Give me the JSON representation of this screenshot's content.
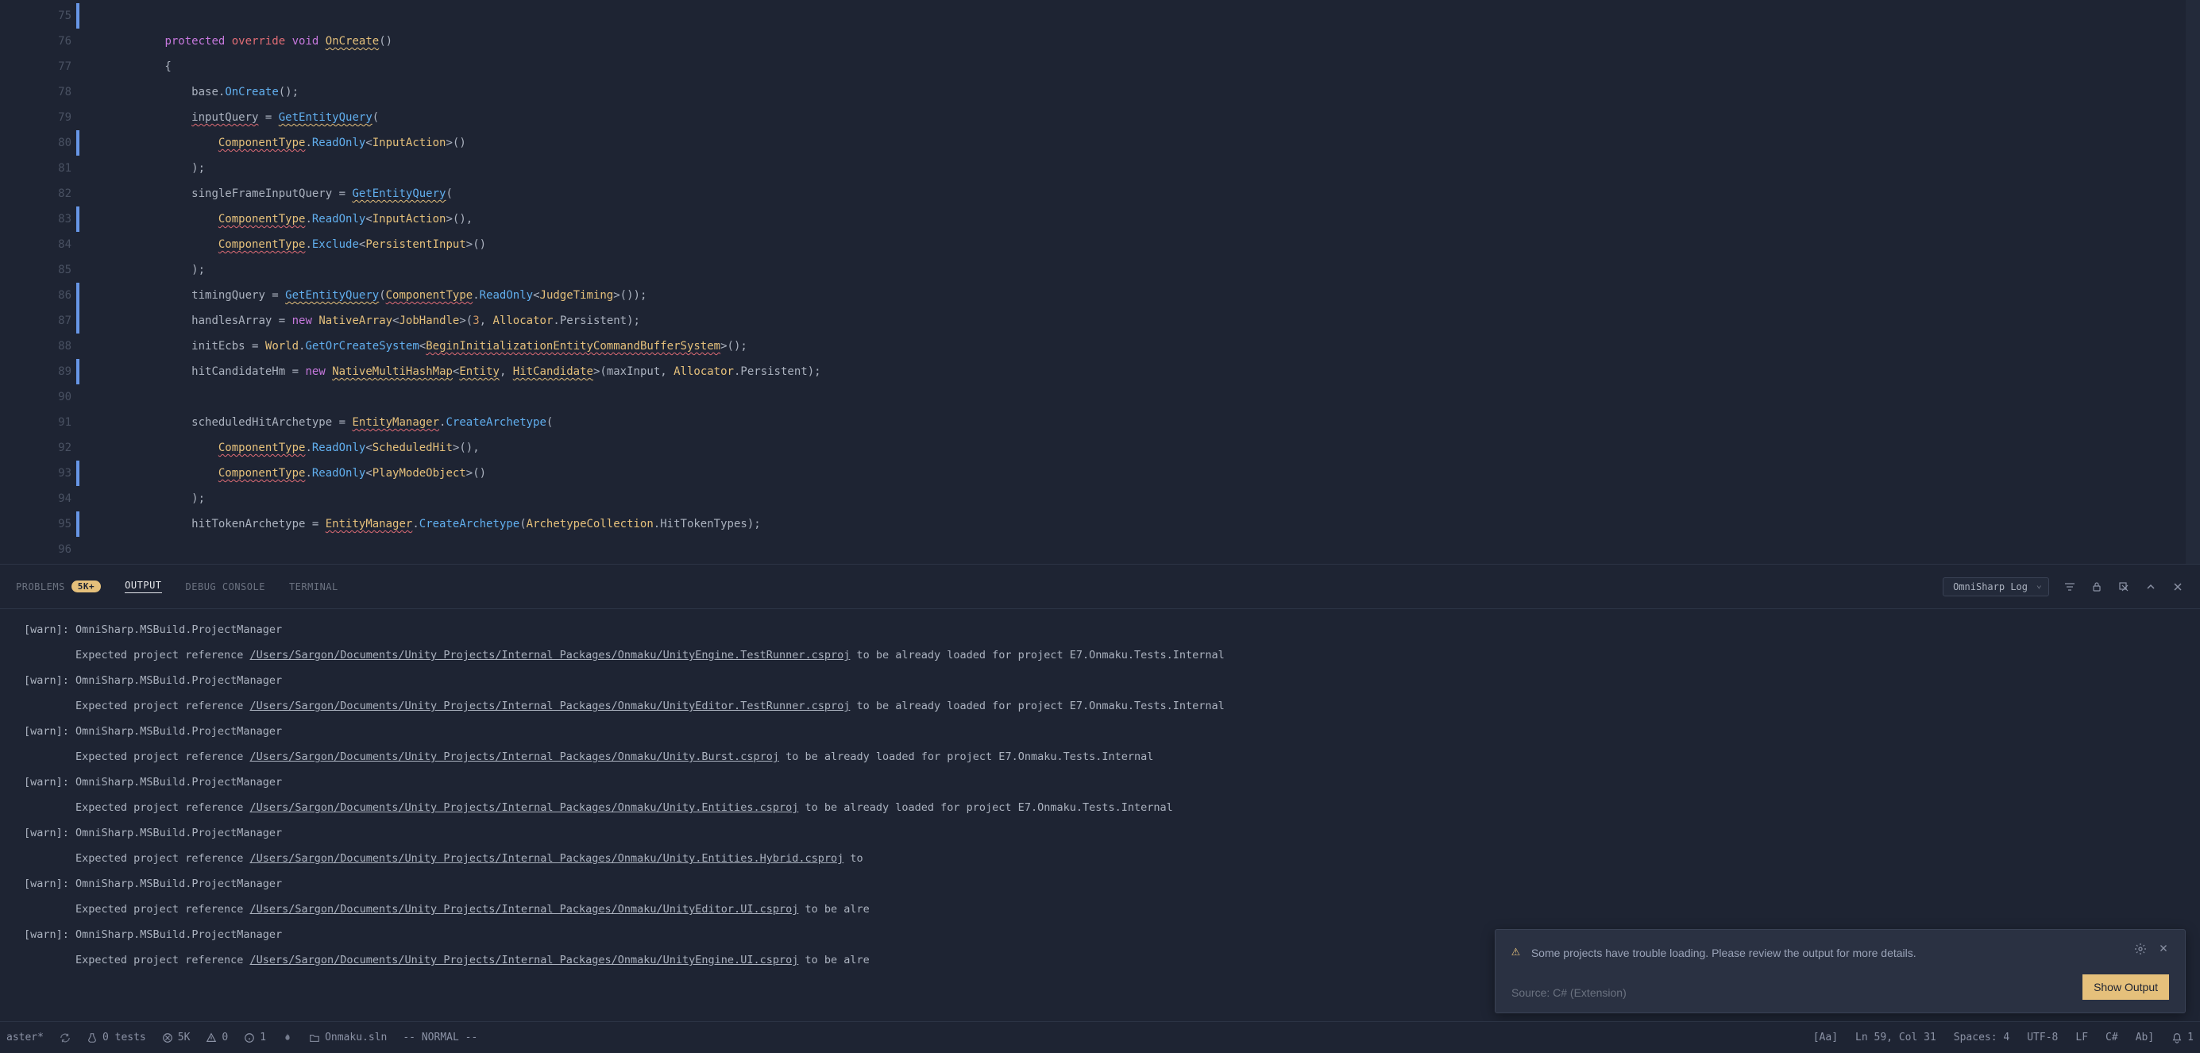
{
  "gutter": {
    "start": 75,
    "end": 96,
    "modified": [
      75,
      80,
      83,
      86,
      87,
      89,
      93,
      95
    ]
  },
  "code": [
    {
      "n": 75,
      "raw": ""
    },
    {
      "n": 76,
      "html": "        <span class='kw'>protected</span> <span class='over'>override</span> <span class='kw'>void</span> <span class='oncreate squiggle-y'>OnCreate</span>()"
    },
    {
      "n": 77,
      "html": "        {"
    },
    {
      "n": 78,
      "html": "            <span class='ident'>base</span>.<span class='method'>OnCreate</span>();"
    },
    {
      "n": 79,
      "html": "            <span class='squiggle'>inputQuery</span> = <span class='method squiggle-y'>GetEntityQuery</span>("
    },
    {
      "n": 80,
      "html": "                <span class='type squiggle'>ComponentType</span>.<span class='method'>ReadOnly</span>&lt;<span class='type'>InputAction</span>&gt;()"
    },
    {
      "n": 81,
      "html": "            );"
    },
    {
      "n": 82,
      "html": "            <span class='ident'>singleFrameInputQuery</span> = <span class='method squiggle-y'>GetEntityQuery</span>("
    },
    {
      "n": 83,
      "html": "                <span class='type squiggle'>ComponentType</span>.<span class='method'>ReadOnly</span>&lt;<span class='type'>InputAction</span>&gt;(),"
    },
    {
      "n": 84,
      "html": "                <span class='type squiggle'>ComponentType</span>.<span class='method'>Exclude</span>&lt;<span class='type'>PersistentInput</span>&gt;()"
    },
    {
      "n": 85,
      "html": "            );"
    },
    {
      "n": 86,
      "html": "            <span class='ident'>timingQuery</span> = <span class='method squiggle-y'>GetEntityQuery</span>(<span class='type squiggle'>ComponentType</span>.<span class='method'>ReadOnly</span>&lt;<span class='type'>JudgeTiming</span>&gt;());"
    },
    {
      "n": 87,
      "html": "            <span class='ident'>handlesArray</span> = <span class='kw'>new</span> <span class='type'>NativeArray</span>&lt;<span class='type'>JobHandle</span>&gt;(<span class='num'>3</span>, <span class='type'>Allocator</span>.<span class='ident'>Persistent</span>);"
    },
    {
      "n": 88,
      "html": "            <span class='ident'>initEcbs</span> = <span class='type'>World</span>.<span class='method'>GetOrCreateSystem</span>&lt;<span class='type squiggle'>BeginInitializationEntityCommandBufferSystem</span>&gt;();"
    },
    {
      "n": 89,
      "html": "            <span class='ident'>hitCandidateHm</span> = <span class='kw'>new</span> <span class='type squiggle-y'>NativeMultiHashMap</span>&lt;<span class='type squiggle-y'>Entity</span>, <span class='type squiggle-y'>HitCandidate</span>&gt;(<span class='ident'>maxInput</span>, <span class='type'>Allocator</span>.<span class='ident'>Persistent</span>);"
    },
    {
      "n": 90,
      "html": ""
    },
    {
      "n": 91,
      "html": "            <span class='ident'>scheduledHitArchetype</span> = <span class='type squiggle'>EntityManager</span>.<span class='method'>CreateArchetype</span>("
    },
    {
      "n": 92,
      "html": "                <span class='type squiggle'>ComponentType</span>.<span class='method'>ReadOnly</span>&lt;<span class='type'>ScheduledHit</span>&gt;(),"
    },
    {
      "n": 93,
      "html": "                <span class='type squiggle'>ComponentType</span>.<span class='method'>ReadOnly</span>&lt;<span class='type'>PlayModeObject</span>&gt;()"
    },
    {
      "n": 94,
      "html": "            );"
    },
    {
      "n": 95,
      "html": "            <span class='ident'>hitTokenArchetype</span> = <span class='type squiggle'>EntityManager</span>.<span class='method'>CreateArchetype</span>(<span class='type'>ArchetypeCollection</span>.<span class='ident'>HitTokenTypes</span>);"
    },
    {
      "n": 96,
      "html": ""
    }
  ],
  "panel": {
    "tabs": {
      "problems": "PROBLEMS",
      "problems_badge": "5K+",
      "output": "OUTPUT",
      "debug": "DEBUG CONSOLE",
      "terminal": "TERMINAL"
    },
    "dropdown": "OmniSharp Log"
  },
  "output_lines": [
    {
      "t": "[warn]: OmniSharp.MSBuild.ProjectManager"
    },
    {
      "t": "        Expected project reference ",
      "p": "/Users/Sargon/Documents/Unity Projects/Internal Packages/Onmaku/UnityEngine.TestRunner.csproj",
      "s": " to be already loaded for project E7.Onmaku.Tests.Internal"
    },
    {
      "t": "[warn]: OmniSharp.MSBuild.ProjectManager"
    },
    {
      "t": "        Expected project reference ",
      "p": "/Users/Sargon/Documents/Unity Projects/Internal Packages/Onmaku/UnityEditor.TestRunner.csproj",
      "s": " to be already loaded for project E7.Onmaku.Tests.Internal"
    },
    {
      "t": "[warn]: OmniSharp.MSBuild.ProjectManager"
    },
    {
      "t": "        Expected project reference ",
      "p": "/Users/Sargon/Documents/Unity Projects/Internal Packages/Onmaku/Unity.Burst.csproj",
      "s": " to be already loaded for project E7.Onmaku.Tests.Internal"
    },
    {
      "t": "[warn]: OmniSharp.MSBuild.ProjectManager"
    },
    {
      "t": "        Expected project reference ",
      "p": "/Users/Sargon/Documents/Unity Projects/Internal Packages/Onmaku/Unity.Entities.csproj",
      "s": " to be already loaded for project E7.Onmaku.Tests.Internal"
    },
    {
      "t": "[warn]: OmniSharp.MSBuild.ProjectManager"
    },
    {
      "t": "        Expected project reference ",
      "p": "/Users/Sargon/Documents/Unity Projects/Internal Packages/Onmaku/Unity.Entities.Hybrid.csproj",
      "s": " to"
    },
    {
      "t": "[warn]: OmniSharp.MSBuild.ProjectManager"
    },
    {
      "t": "        Expected project reference ",
      "p": "/Users/Sargon/Documents/Unity Projects/Internal Packages/Onmaku/UnityEditor.UI.csproj",
      "s": " to be alre"
    },
    {
      "t": "[warn]: OmniSharp.MSBuild.ProjectManager"
    },
    {
      "t": "        Expected project reference ",
      "p": "/Users/Sargon/Documents/Unity Projects/Internal Packages/Onmaku/UnityEngine.UI.csproj",
      "s": " to be alre"
    }
  ],
  "notification": {
    "message": "Some projects have trouble loading. Please review the output for more details.",
    "source": "Source: C# (Extension)",
    "button": "Show Output"
  },
  "statusbar": {
    "branch": "aster*",
    "tests": "0 tests",
    "errors": "5K",
    "warnings": "0",
    "info": "1",
    "solution": "Onmaku.sln",
    "mode": "-- NORMAL --",
    "case": "[Aa]",
    "pos": "Ln 59, Col 31",
    "spaces": "Spaces: 4",
    "encoding": "UTF-8",
    "eol": "LF",
    "lang": "C#",
    "tab": "Ab]",
    "notif": "1"
  }
}
